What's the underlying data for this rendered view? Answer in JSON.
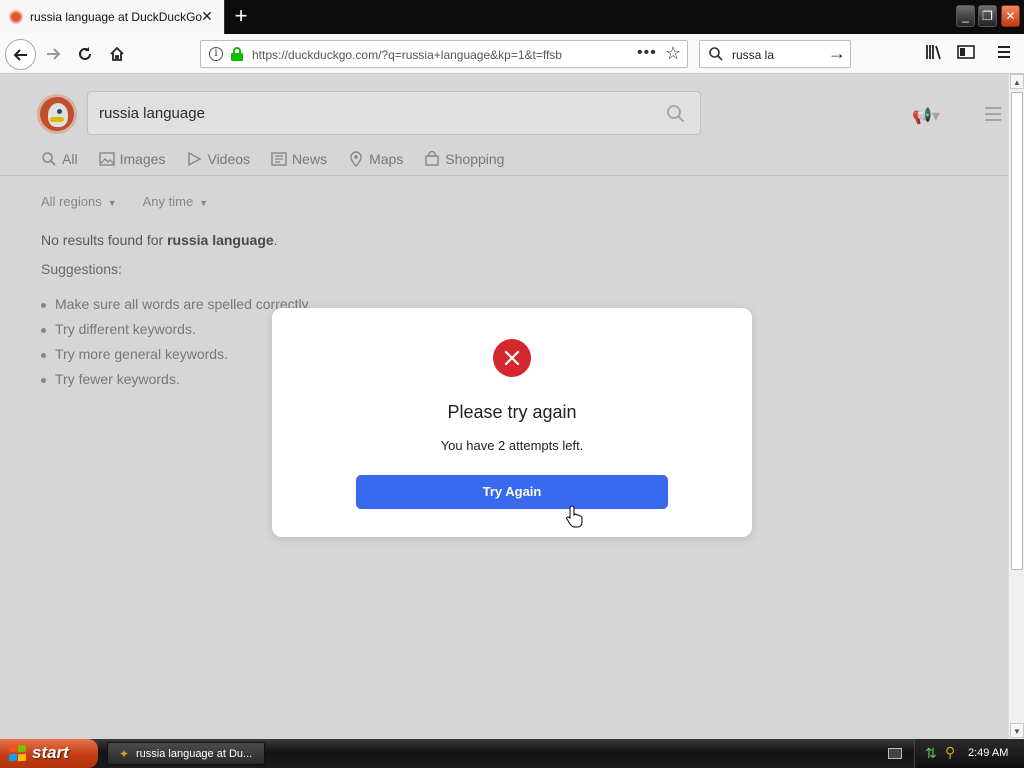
{
  "browser": {
    "tab_title": "russia language at DuckDuckGo",
    "tab_close": "✕",
    "new_tab": "+",
    "window_buttons": {
      "minimize": "_",
      "restore": "❐",
      "close": "✕"
    },
    "url": "https://duckduckgo.com/?q=russia+language&kp=1&t=ffsb",
    "search_value": "russa la",
    "page_actions": "•••"
  },
  "ddg": {
    "search_value": "russia language",
    "tabs": [
      {
        "label": "All",
        "icon": "search-icon"
      },
      {
        "label": "Images",
        "icon": "image-icon"
      },
      {
        "label": "Videos",
        "icon": "play-icon"
      },
      {
        "label": "News",
        "icon": "news-icon"
      },
      {
        "label": "Maps",
        "icon": "map-pin-icon"
      },
      {
        "label": "Shopping",
        "icon": "shopping-bag-icon"
      }
    ],
    "filters": {
      "region": "All regions",
      "time": "Any time"
    },
    "no_results_prefix": "No results found for ",
    "no_results_query": "russia language",
    "no_results_suffix": ".",
    "suggestions_label": "Suggestions:",
    "suggestions": [
      "Make sure all words are spelled correctly.",
      "Try different keywords.",
      "Try more general keywords.",
      "Try fewer keywords."
    ]
  },
  "modal": {
    "title": "Please try again",
    "message": "You have 2 attempts left.",
    "button": "Try Again",
    "colors": {
      "error": "#d5282e",
      "button": "#3969ef"
    }
  },
  "taskbar": {
    "start": "start",
    "task_label": "russia language at Du...",
    "clock": "2:49 AM"
  }
}
